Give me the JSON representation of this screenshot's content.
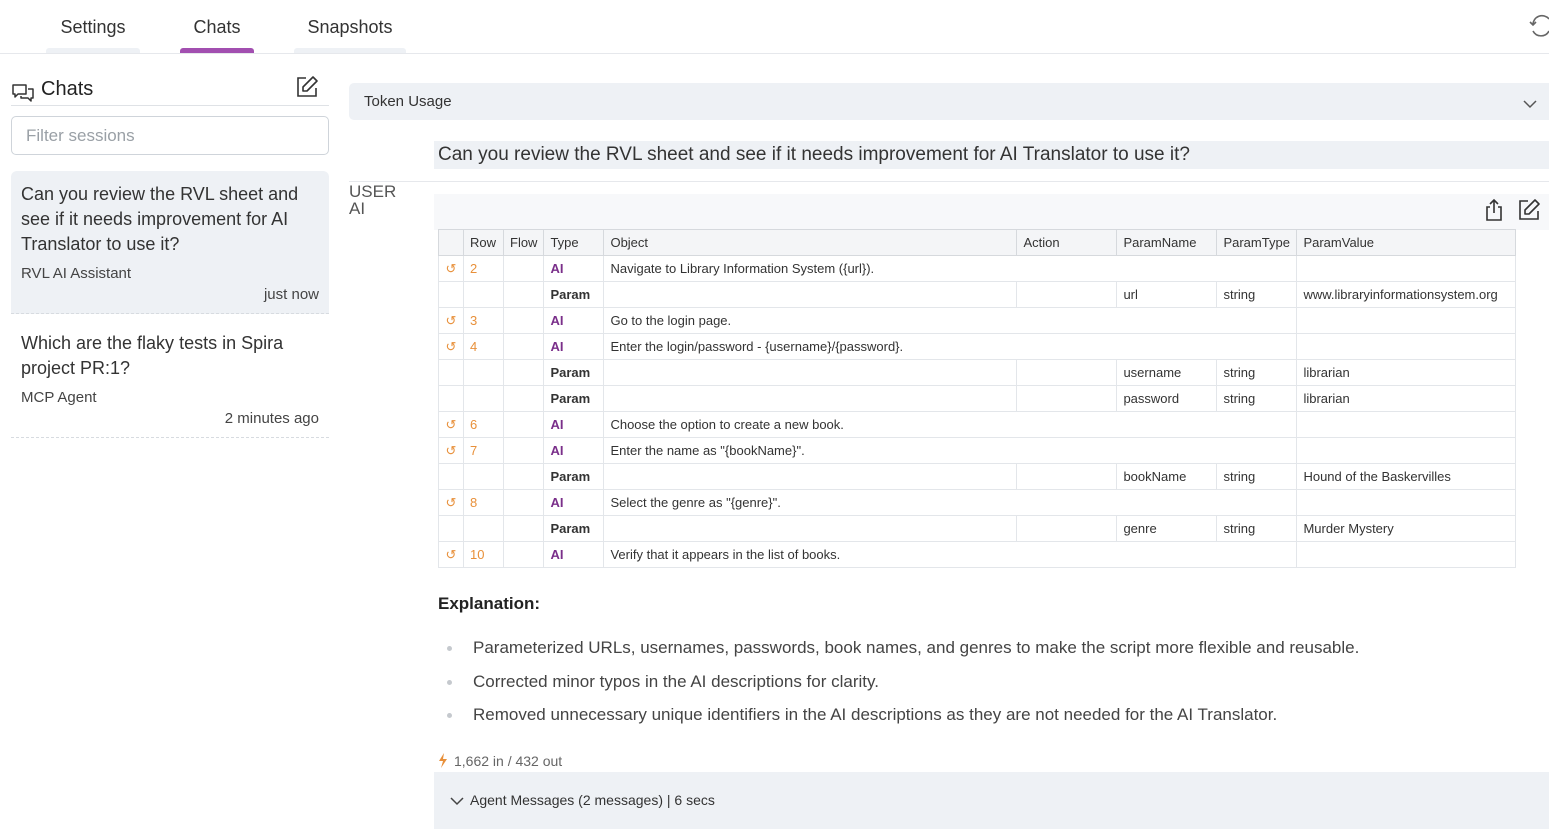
{
  "tabs": [
    {
      "label": "Settings",
      "active": false
    },
    {
      "label": "Chats",
      "active": true
    },
    {
      "label": "Snapshots",
      "active": false
    }
  ],
  "sidebar": {
    "title": "Chats",
    "filter_placeholder": "Filter sessions",
    "sessions": [
      {
        "title": "Can you review the RVL sheet and see if it needs improvement for AI Translator to use it?",
        "agent": "RVL AI Assistant",
        "time": "just now",
        "active": true
      },
      {
        "title": "Which are the flaky tests in Spira project PR:1?",
        "agent": "MCP Agent",
        "time": "2 minutes ago",
        "active": false
      }
    ]
  },
  "main": {
    "token_usage_label": "Token Usage",
    "user_role": "USER",
    "user_message": "Can you review the RVL sheet and see if it needs improvement for AI Translator to use it?",
    "ai_role": "AI",
    "table": {
      "headers": [
        "",
        "Row",
        "Flow",
        "Type",
        "Object",
        "Action",
        "ParamName",
        "ParamType",
        "ParamValue"
      ],
      "rows": [
        {
          "icon": "↺",
          "row": "2",
          "flow": "",
          "type": "AI",
          "object": "Navigate to Library Information System ({url}).",
          "action": "",
          "param_name": "",
          "param_type": "",
          "param_value": ""
        },
        {
          "icon": "",
          "row": "",
          "flow": "",
          "type": "Param",
          "object": "",
          "action": "",
          "param_name": "url",
          "param_type": "string",
          "param_value": "www.libraryinformationsystem.org"
        },
        {
          "icon": "↺",
          "row": "3",
          "flow": "",
          "type": "AI",
          "object": "Go to the login page.",
          "action": "",
          "param_name": "",
          "param_type": "",
          "param_value": ""
        },
        {
          "icon": "↺",
          "row": "4",
          "flow": "",
          "type": "AI",
          "object": "Enter the login/password - {username}/{password}.",
          "action": "",
          "param_name": "",
          "param_type": "",
          "param_value": ""
        },
        {
          "icon": "",
          "row": "",
          "flow": "",
          "type": "Param",
          "object": "",
          "action": "",
          "param_name": "username",
          "param_type": "string",
          "param_value": "librarian"
        },
        {
          "icon": "",
          "row": "",
          "flow": "",
          "type": "Param",
          "object": "",
          "action": "",
          "param_name": "password",
          "param_type": "string",
          "param_value": "librarian"
        },
        {
          "icon": "↺",
          "row": "6",
          "flow": "",
          "type": "AI",
          "object": "Choose the option to create a new book.",
          "action": "",
          "param_name": "",
          "param_type": "",
          "param_value": ""
        },
        {
          "icon": "↺",
          "row": "7",
          "flow": "",
          "type": "AI",
          "object": "Enter the name as \"{bookName}\".",
          "action": "",
          "param_name": "",
          "param_type": "",
          "param_value": ""
        },
        {
          "icon": "",
          "row": "",
          "flow": "",
          "type": "Param",
          "object": "",
          "action": "",
          "param_name": "bookName",
          "param_type": "string",
          "param_value": "Hound of the Baskervilles"
        },
        {
          "icon": "↺",
          "row": "8",
          "flow": "",
          "type": "AI",
          "object": "Select the genre as \"{genre}\".",
          "action": "",
          "param_name": "",
          "param_type": "",
          "param_value": ""
        },
        {
          "icon": "",
          "row": "",
          "flow": "",
          "type": "Param",
          "object": "",
          "action": "",
          "param_name": "genre",
          "param_type": "string",
          "param_value": "Murder Mystery"
        },
        {
          "icon": "↺",
          "row": "10",
          "flow": "",
          "type": "AI",
          "object": "Verify that it appears in the list of books.",
          "action": "",
          "param_name": "",
          "param_type": "",
          "param_value": ""
        }
      ]
    },
    "explanation_title": "Explanation:",
    "explanation_items": [
      "Parameterized URLs, usernames, passwords, book names, and genres to make the script more flexible and reusable.",
      "Corrected minor typos in the AI descriptions for clarity.",
      "Removed unnecessary unique identifiers in the AI descriptions as they are not needed for the AI Translator."
    ],
    "token_count": "1,662 in / 432 out",
    "agent_messages": "Agent Messages (2 messages) | 6 secs"
  },
  "colors": {
    "accent": "#a24fb0",
    "ai_type": "#7a2f8a",
    "row_number": "#e8903a",
    "panel_bg": "#eef1f5"
  },
  "icons": [
    "refresh-icon",
    "chat-bubbles-icon",
    "new-chat-icon",
    "chevron-down-icon",
    "share-icon",
    "edit-icon",
    "row-action-icon",
    "bolt-icon"
  ]
}
